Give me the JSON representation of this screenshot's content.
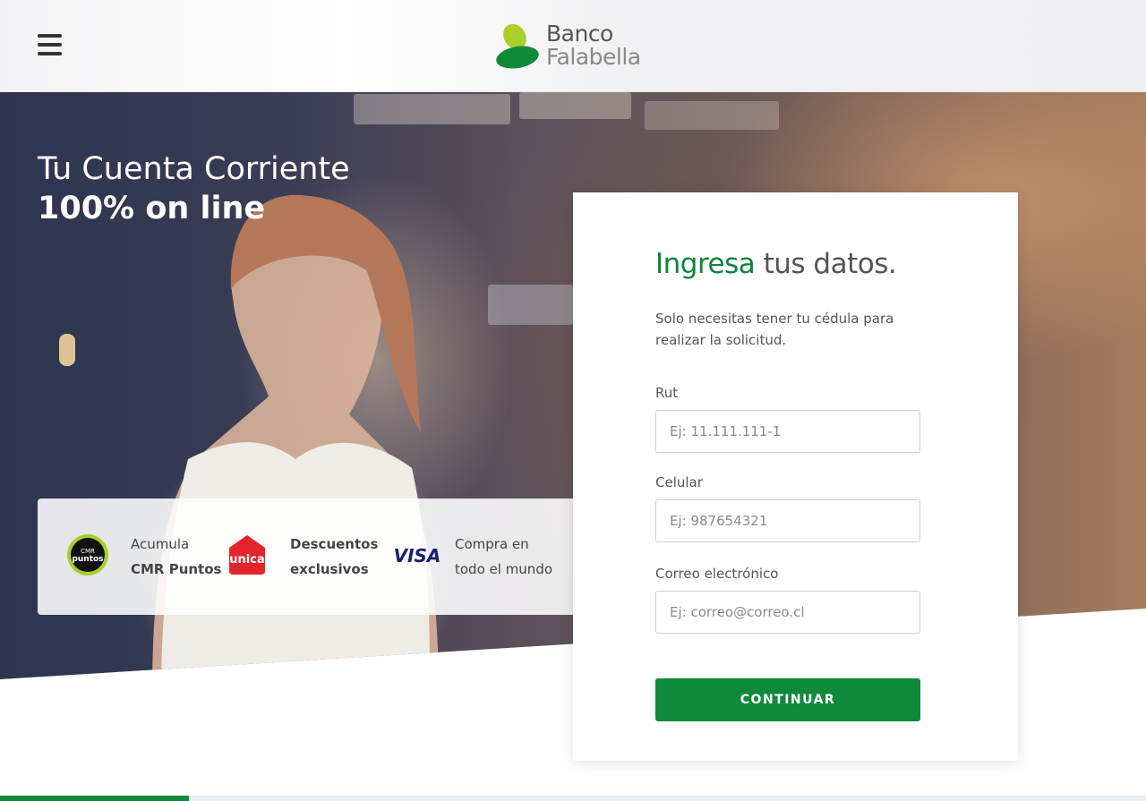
{
  "header": {
    "menu_icon": "hamburger-menu-icon",
    "logo": {
      "line1": "Banco",
      "line2": "Falabella",
      "colors": {
        "green": "#0f8a3b",
        "lime": "#a8cf2a"
      }
    }
  },
  "hero": {
    "title_line1": "Tu Cuenta Corriente",
    "title_line2": "100% on line"
  },
  "benefits": [
    {
      "icon": "cmr-puntos-icon",
      "icon_text": "CMR puntos",
      "line1": "Acumula",
      "line2": "CMR Puntos"
    },
    {
      "icon": "unica-icon",
      "icon_text": "unica",
      "line1": "Descuentos",
      "line2": "exclusivos"
    },
    {
      "icon": "visa-icon",
      "icon_text": "VISA",
      "line1": "Compra en",
      "line2": "todo el mundo"
    }
  ],
  "form": {
    "title_accent": "Ingresa",
    "title_rest": " tus datos.",
    "description": "Solo necesitas tener tu cédula para realizar la solicitud.",
    "fields": [
      {
        "label": "Rut",
        "placeholder": "Ej: 11.111.111-1",
        "value": ""
      },
      {
        "label": "Celular",
        "placeholder": "Ej: 987654321",
        "value": ""
      },
      {
        "label": "Correo electrónico",
        "placeholder": "Ej: correo@correo.cl",
        "value": ""
      }
    ],
    "submit_label": "CONTINUAR"
  },
  "progress": {
    "fraction": 0.165
  },
  "colors": {
    "accent": "#0f8a3b",
    "text": "#555555"
  }
}
